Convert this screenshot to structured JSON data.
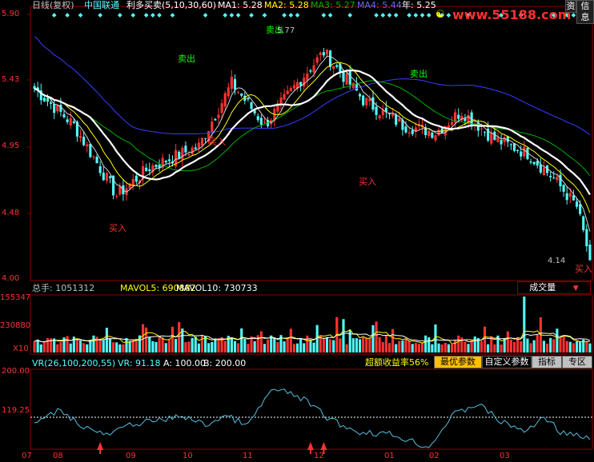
{
  "header": {
    "period": "日线(复权)",
    "stock": "中国联通",
    "indicator": "利多买卖(5,10,30,60)",
    "ma1_label": "MA1: 5.28",
    "ma2_label": "MA2: 5.28",
    "ma3_label": "MA3: 5.27",
    "ma4_label": "MA4: 5.44",
    "year_label": "年: 5.25",
    "tab1": "资",
    "tab2": "信息",
    "watermark": "www.55188.com"
  },
  "colors": {
    "up": "#ff3232",
    "down": "#54fcfc",
    "ma5": "#ffffff",
    "ma10": "#ffff00",
    "ma30": "#00b000",
    "ma60": "#3c3cff",
    "year": "#ffffff",
    "grid": "#8b0000",
    "buy": "#ff3232",
    "sell": "#00ff00"
  },
  "price_panel": {
    "y_ticks": [
      "5.90",
      "5.43",
      "4.95",
      "4.48",
      "4.00"
    ],
    "high_label": "5.77",
    "low_label": "4.14",
    "signals": [
      {
        "type": "sell",
        "text": "卖出"
      },
      {
        "type": "sell",
        "text": "卖出"
      },
      {
        "type": "sell",
        "text": "卖出"
      },
      {
        "type": "buy",
        "text": "买入"
      },
      {
        "type": "buy",
        "text": "买入"
      },
      {
        "type": "buy",
        "text": "买入"
      },
      {
        "type": "buy",
        "text": "买入"
      }
    ]
  },
  "volume_panel": {
    "total_label": "总手: 1051312",
    "mavol5_label": "MAVOL5: 690882",
    "mavol10_label": "MAVOL10: 730733",
    "selector": "成交量",
    "y_ticks": [
      "155347",
      "230880",
      "X10"
    ]
  },
  "vr_panel": {
    "vr_params": "VR(26,100,200,55)",
    "vr_value": "VR: 91.18",
    "a_value": "A: 100.00",
    "b_value": "B: 200.00",
    "excess_return": "超额收益率56%",
    "btn_best": "最优参数",
    "btn_custom": "自定义参数",
    "btn_indicator": "指标",
    "btn_zone": "专区",
    "y_ticks": [
      "200.00",
      "119.25"
    ]
  },
  "x_axis": {
    "labels": [
      "07",
      "08",
      "09",
      "10",
      "11",
      "12",
      "01",
      "02",
      "03"
    ]
  }
}
